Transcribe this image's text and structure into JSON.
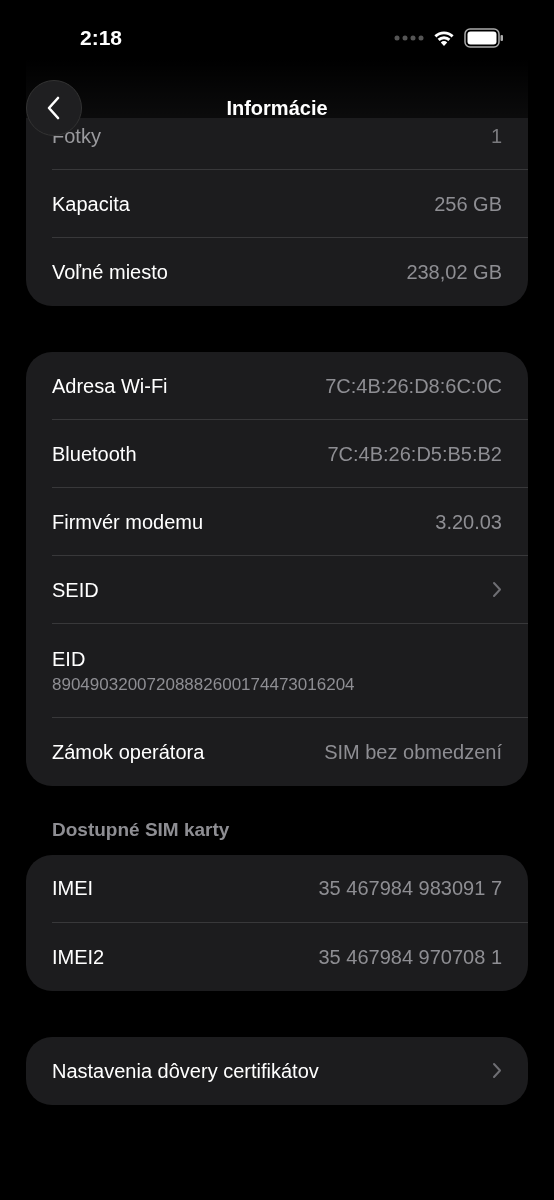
{
  "status_bar": {
    "time": "2:18"
  },
  "nav": {
    "title": "Informácie"
  },
  "sections": [
    {
      "rows": [
        {
          "kind": "value",
          "label": "Fotky",
          "value": "1",
          "obscured": true
        },
        {
          "kind": "value",
          "label": "Kapacita",
          "value": "256 GB",
          "obscured": false
        },
        {
          "kind": "value",
          "label": "Voľné miesto",
          "value": "238,02 GB",
          "obscured": false
        }
      ]
    },
    {
      "rows": [
        {
          "kind": "value",
          "label": "Adresa Wi-Fi",
          "value": "7C:4B:26:D8:6C:0C",
          "obscured": false
        },
        {
          "kind": "value",
          "label": "Bluetooth",
          "value": "7C:4B:26:D5:B5:B2",
          "obscured": false
        },
        {
          "kind": "value",
          "label": "Firmvér modemu",
          "value": "3.20.03",
          "obscured": false
        },
        {
          "kind": "chevron",
          "label": "SEID",
          "obscured": false
        },
        {
          "kind": "stacked",
          "label": "EID",
          "value": "89049032007208882600174473016204",
          "obscured": false
        },
        {
          "kind": "value",
          "label": "Zámok operátora",
          "value": "SIM bez obmedzení",
          "obscured": false
        }
      ]
    },
    {
      "header": "Dostupné SIM karty",
      "rows": [
        {
          "kind": "value",
          "label": "IMEI",
          "value": "35 467984 983091 7",
          "obscured": false
        },
        {
          "kind": "value",
          "label": "IMEI2",
          "value": "35 467984 970708 1",
          "obscured": false
        }
      ]
    },
    {
      "rows": [
        {
          "kind": "chevron",
          "label": "Nastavenia dôvery certifikátov",
          "obscured": false
        }
      ]
    }
  ]
}
